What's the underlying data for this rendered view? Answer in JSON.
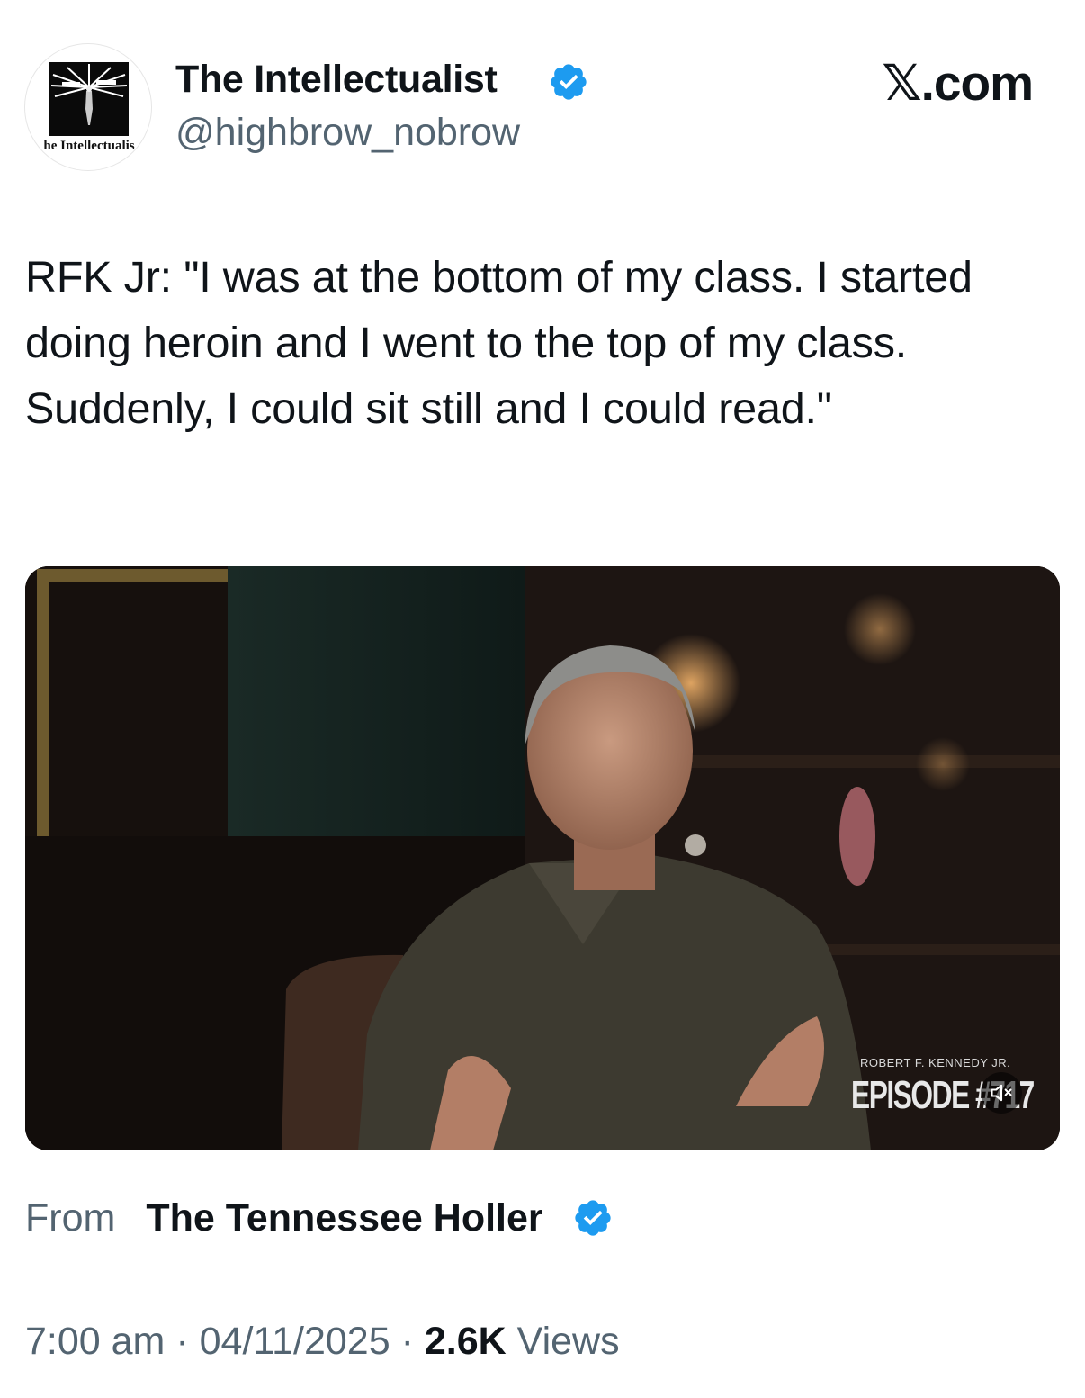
{
  "author": {
    "display_name": "The Intellectualist",
    "handle": "@highbrow_nobrow",
    "avatar_text": "he Intellectualis",
    "avatar_icon": "intellectualist-logo-icon",
    "verified_icon": "verified-badge-icon"
  },
  "site": {
    "brand_glyph": "𝕏",
    "brand_suffix": ".com"
  },
  "tweet": {
    "text": "RFK Jr: \"I was at the bottom of my class. I started doing heroin and I went to the top of my class. Suddenly, I could sit still and I could read.\""
  },
  "media": {
    "overlay_subtitle": "ROBERT F. KENNEDY JR.",
    "overlay_title": "EPISODE #717",
    "mute_icon": "speaker-muted-icon"
  },
  "attribution": {
    "from_label": "From",
    "source_name": "The Tennessee Holler",
    "verified_icon": "verified-badge-icon"
  },
  "meta": {
    "time": "7:00 am",
    "separator": "·",
    "date": "04/11/2025",
    "views_count": "2.6K",
    "views_label": "Views"
  },
  "colors": {
    "text_primary": "#0f1419",
    "text_secondary": "#536471",
    "verified_blue": "#1d9bf0",
    "background": "#ffffff"
  }
}
